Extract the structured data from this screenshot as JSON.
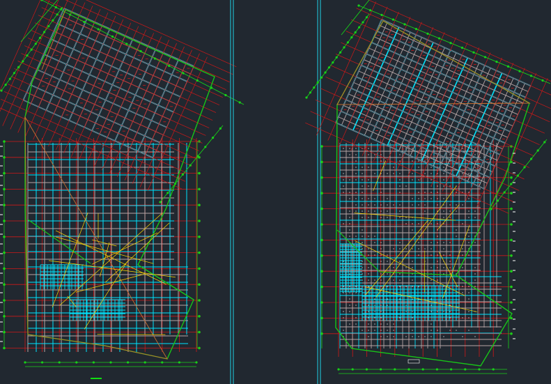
{
  "app": {
    "name": "",
    "background": "#212830"
  },
  "colors": {
    "grid_axis": "#d01818",
    "beam": "#00e5ff",
    "beam_alt": "#b6a6a6",
    "outline": "#18c418",
    "dimension": "#18d018",
    "dimension_marker": "#ffffff",
    "wall_accent": "#c87030",
    "tag": "#ffd800",
    "divider": "#1fb6c8",
    "scale_bar": "#10e010"
  },
  "viewports": [
    {
      "name": "left-plan",
      "title_tag": "",
      "has_scale_bar": true
    },
    {
      "name": "right-plan",
      "title_tag": "",
      "has_scale_bar": false
    }
  ]
}
